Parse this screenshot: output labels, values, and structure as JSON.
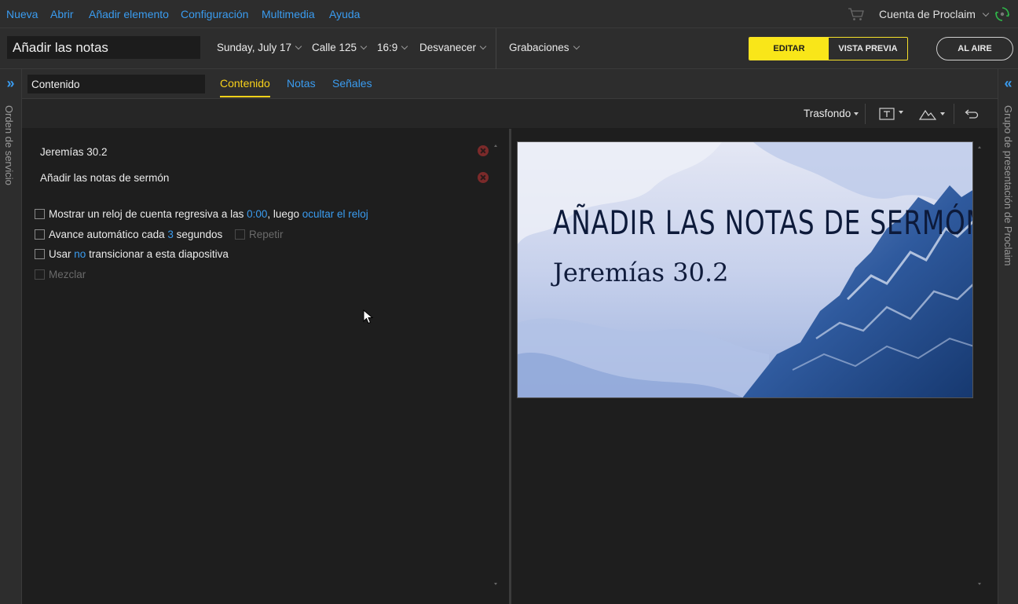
{
  "menu": {
    "items": [
      "Nueva",
      "Abrir",
      "Añadir elemento",
      "Configuración",
      "Multimedia",
      "Ayuda"
    ],
    "account_label": "Cuenta de Proclaim",
    "cart_icon": "cart-icon",
    "sync_icon": "sync-icon"
  },
  "toolbar": {
    "title_value": "Añadir las notas",
    "date": "Sunday, July 17",
    "location": "Calle 125",
    "aspect": "16:9",
    "transition": "Desvanecer",
    "recordings": "Grabaciones",
    "edit_label": "EDITAR",
    "preview_label": "VISTA PREVIA",
    "on_air_label": "AL AIRE"
  },
  "rails": {
    "left_label": "Orden de servicio",
    "right_label": "Grupo de presentación de Proclaim",
    "left_chevron": "»",
    "right_chevron": "«"
  },
  "tabs": {
    "content_input_value": "Contenido",
    "items": [
      "Contenido",
      "Notas",
      "Señales"
    ],
    "active": "Contenido"
  },
  "subbar": {
    "background_label": "Trasfondo",
    "text_tool_icon": "text-box-icon",
    "image_tool_icon": "image-mountain-icon",
    "undo_icon": "undo-icon"
  },
  "content": {
    "items": [
      {
        "label": "Jeremías 30.2"
      },
      {
        "label": "Añadir las notas de sermón"
      }
    ],
    "options": {
      "countdown": {
        "prefix": "Mostrar un reloj de cuenta regresiva a las",
        "time": "0:00",
        "middle": ", luego",
        "action": "ocultar el reloj"
      },
      "advance": {
        "prefix": "Avance automático cada",
        "seconds": "3",
        "suffix": "segundos",
        "repeat": "Repetir"
      },
      "transition": {
        "prefix": "Usar",
        "value": "no",
        "suffix": "transicionar a esta diapositiva"
      },
      "shuffle": "Mezclar"
    }
  },
  "preview": {
    "title": "AÑADIR LAS NOTAS DE SERMÓN",
    "subtitle": "Jeremías 30.2"
  },
  "colors": {
    "accent_blue": "#3a9cf0",
    "accent_yellow": "#f9e619",
    "panel_bg": "#1e1e1e",
    "chrome_bg": "#2d2d2d"
  }
}
